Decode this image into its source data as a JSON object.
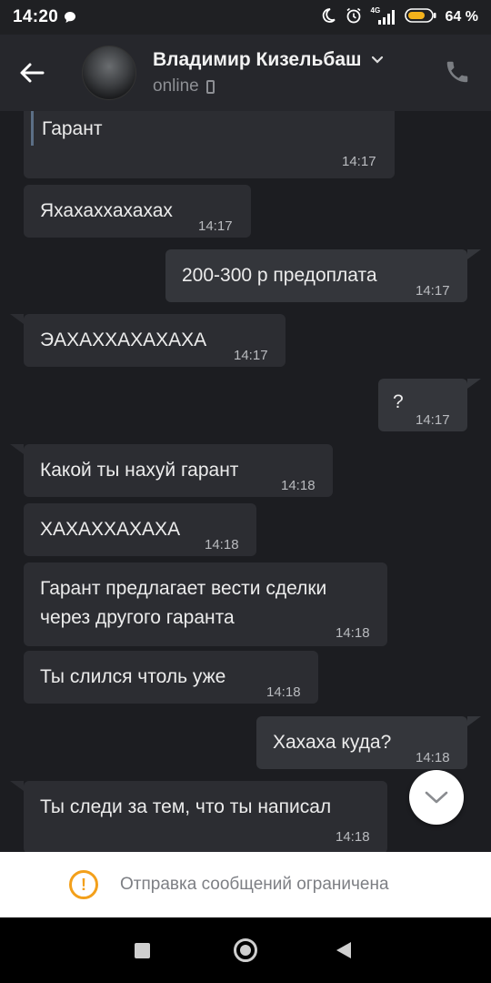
{
  "status_bar": {
    "time": "14:20",
    "network": "4G",
    "battery": "64 %"
  },
  "header": {
    "contact_name": "Владимир Кизельбаш",
    "status": "online"
  },
  "messages": [
    {
      "direction": "in",
      "text": "Гарант",
      "time": "14:17",
      "quoted": true
    },
    {
      "direction": "in",
      "text": "Яхахаххахахах",
      "time": "14:17"
    },
    {
      "direction": "out",
      "text": "200-300 р предоплата",
      "time": "14:17"
    },
    {
      "direction": "in",
      "text": "ЭАХАХХАХАХАХА",
      "time": "14:17"
    },
    {
      "direction": "out",
      "text": "?",
      "time": "14:17"
    },
    {
      "direction": "in",
      "text": "Какой ты нахуй гарант",
      "time": "14:18"
    },
    {
      "direction": "in",
      "text": "ХАХАХХАХАХА",
      "time": "14:18"
    },
    {
      "direction": "in",
      "text_line1": "Гарант предлагает вести сделки",
      "text_line2": "через другого гаранта",
      "time": "14:18"
    },
    {
      "direction": "in",
      "text": "Ты слился чтоль уже",
      "time": "14:18"
    },
    {
      "direction": "out",
      "text": "Хахаха куда?",
      "time": "14:18"
    },
    {
      "direction": "in",
      "text": "Ты следи за тем, что ты написал",
      "time": "14:18"
    }
  ],
  "restriction": {
    "text": "Отправка сообщений ограничена"
  },
  "colors": {
    "background": "#1c1d21",
    "incoming_bubble": "#2c2d32",
    "outgoing_bubble": "#34363b",
    "warning": "#f3a01b"
  }
}
